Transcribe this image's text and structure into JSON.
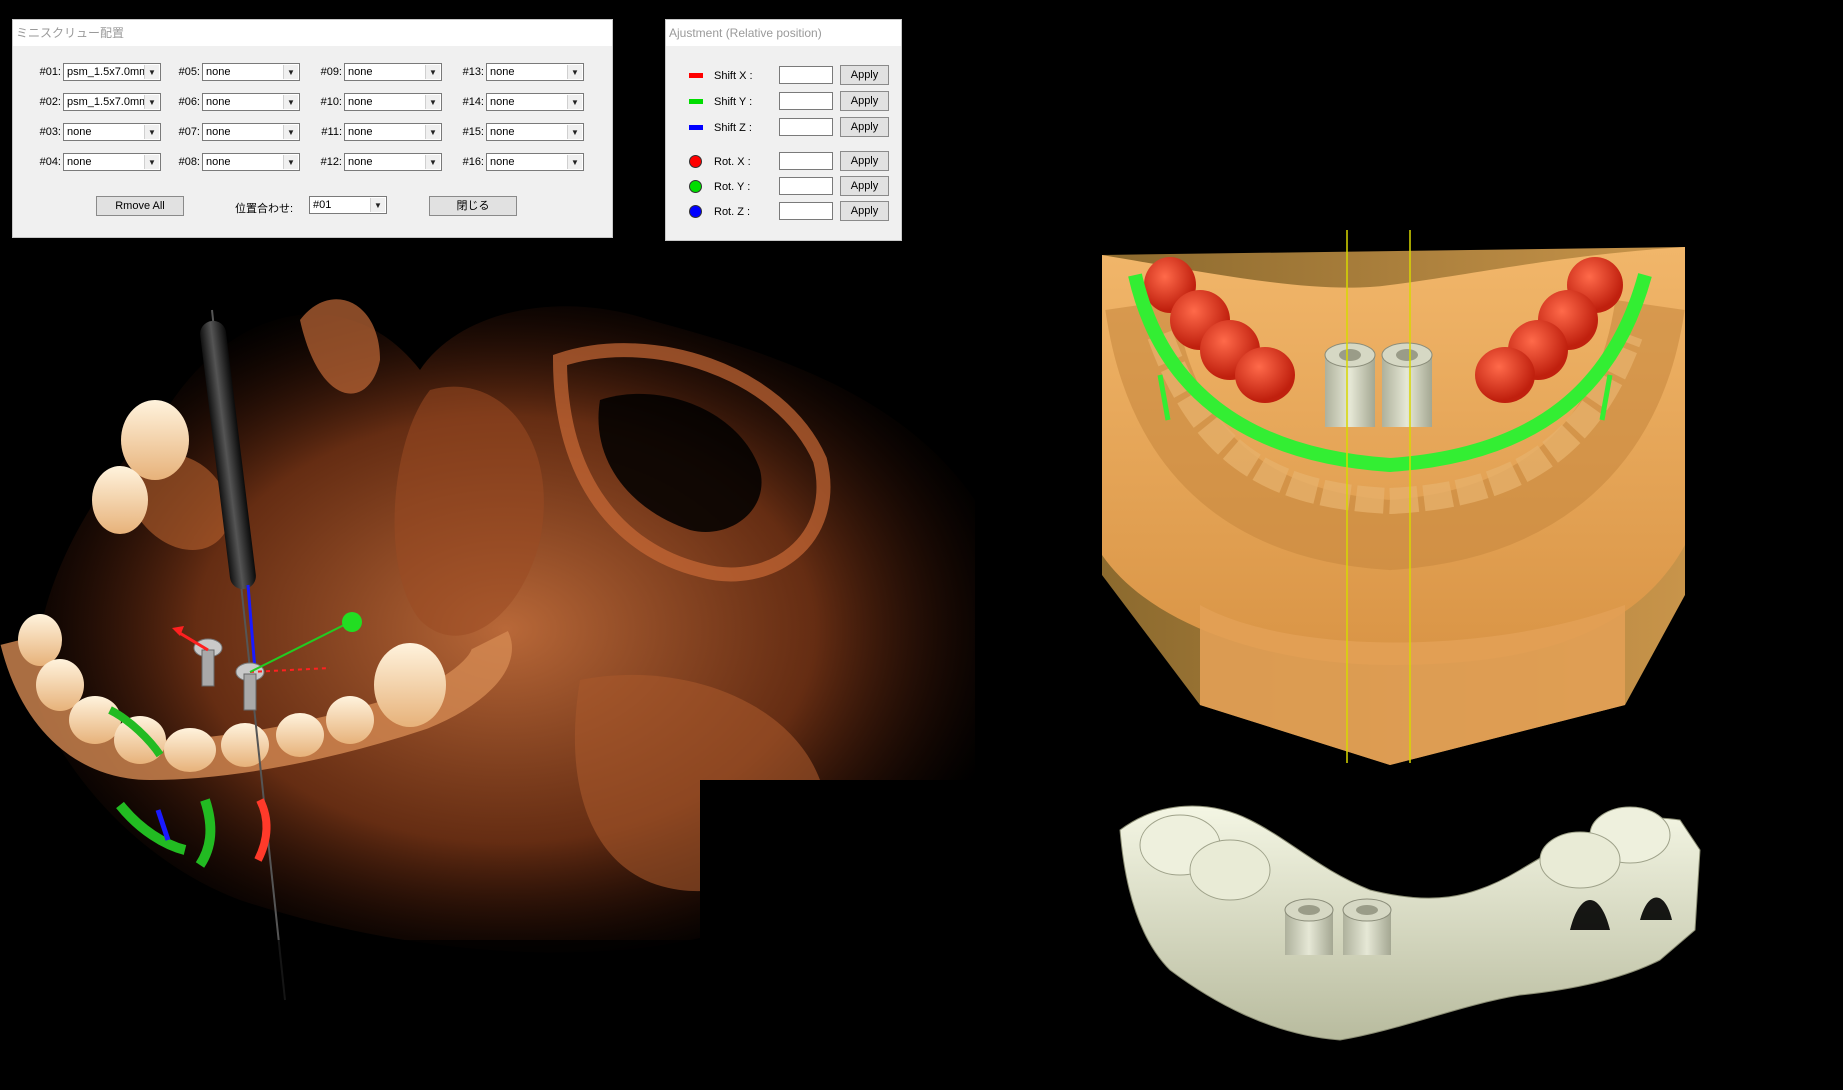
{
  "screw_dialog": {
    "title": "ミニスクリュー配置",
    "slots": [
      {
        "label": "#01:",
        "value": "psm_1.5x7.0mm"
      },
      {
        "label": "#02:",
        "value": "psm_1.5x7.0mm"
      },
      {
        "label": "#03:",
        "value": "none"
      },
      {
        "label": "#04:",
        "value": "none"
      },
      {
        "label": "#05:",
        "value": "none"
      },
      {
        "label": "#06:",
        "value": "none"
      },
      {
        "label": "#07:",
        "value": "none"
      },
      {
        "label": "#08:",
        "value": "none"
      },
      {
        "label": "#09:",
        "value": "none"
      },
      {
        "label": "#10:",
        "value": "none"
      },
      {
        "label": "#11:",
        "value": "none"
      },
      {
        "label": "#12:",
        "value": "none"
      },
      {
        "label": "#13:",
        "value": "none"
      },
      {
        "label": "#14:",
        "value": "none"
      },
      {
        "label": "#15:",
        "value": "none"
      },
      {
        "label": "#16:",
        "value": "none"
      }
    ],
    "remove_all_label": "Rmove All",
    "align_label": "位置合わせ:",
    "align_value": "#01",
    "close_label": "閉じる"
  },
  "adjust_dialog": {
    "title": "Ajustment (Relative position)",
    "rows": [
      {
        "label": "Shift X :",
        "color": "#ff0000",
        "marker": "bar",
        "button": "Apply"
      },
      {
        "label": "Shift Y :",
        "color": "#00dd00",
        "marker": "bar",
        "button": "Apply"
      },
      {
        "label": "Shift Z :",
        "color": "#0000ff",
        "marker": "bar",
        "button": "Apply"
      },
      {
        "label": "Rot. X :",
        "color": "#ff0000",
        "marker": "dot",
        "button": "Apply"
      },
      {
        "label": "Rot. Y :",
        "color": "#00dd00",
        "marker": "dot",
        "button": "Apply"
      },
      {
        "label": "Rot. Z :",
        "color": "#0000ff",
        "marker": "dot",
        "button": "Apply"
      }
    ]
  },
  "colors": {
    "ct_bone": "#b4562a",
    "model_base": "#e6a55a",
    "guide_rim": "#33ee33",
    "teeth_overlay": "#e53a20",
    "guide_shell": "#e3e6c9",
    "axis_line": "#d8d800"
  }
}
